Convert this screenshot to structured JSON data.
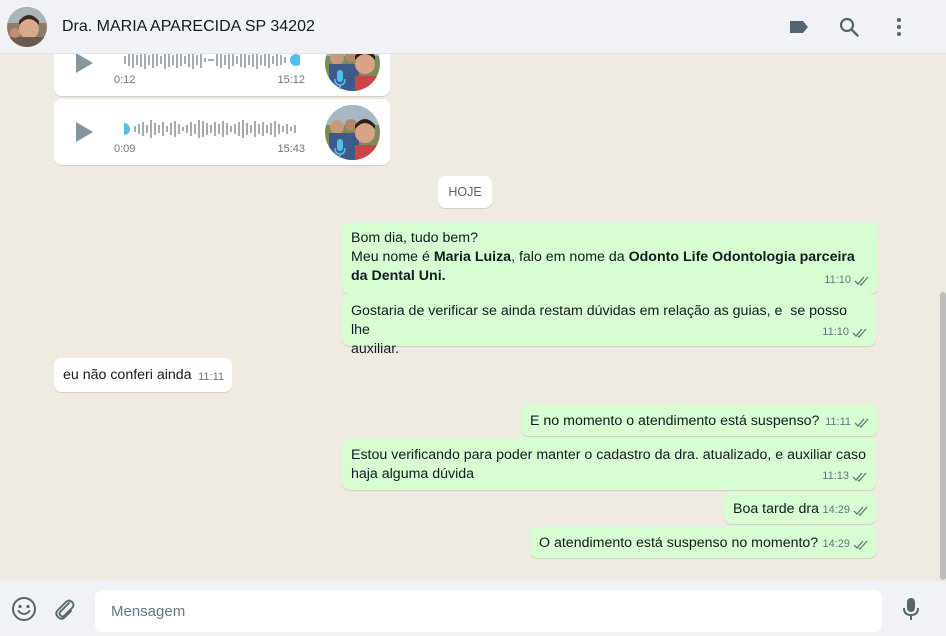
{
  "header": {
    "contact_name": "Dra. MARIA APARECIDA SP 34202",
    "icons": [
      "label-icon",
      "search-icon",
      "menu-icon"
    ]
  },
  "chat": {
    "audio_messages": [
      {
        "duration": "0:12",
        "time": "15:12",
        "progress": 1.0
      },
      {
        "duration": "0:09",
        "time": "15:43",
        "progress": 0.0
      }
    ],
    "date_divider": "HOJE",
    "messages": [
      {
        "direction": "out",
        "line1": "Bom dia, tudo bem?",
        "line2_pre": "Meu nome é ",
        "line2_bold1": "Maria Luiza",
        "line2_mid": ", falo em nome da ",
        "line2_bold2": "Odonto Life Odontologia parceira",
        "line3_bold": "da Dental Uni.",
        "time": "11:10"
      },
      {
        "direction": "out",
        "text": "Gostaria de verificar se ainda restam dúvidas em relação as guias, e  se posso lhe\nauxiliar.",
        "time": "11:10"
      },
      {
        "direction": "in",
        "text": "eu não conferi ainda",
        "time": "11:11"
      },
      {
        "direction": "out",
        "text": "E no momento o atendimento está suspenso?",
        "time": "11:11"
      },
      {
        "direction": "out",
        "text": "Estou verificando para poder manter o cadastro da dra. atualizado, e auxiliar caso\nhaja alguma dúvida",
        "time": "11:13"
      },
      {
        "direction": "out",
        "text": "Boa tarde dra",
        "time": "14:29"
      },
      {
        "direction": "out",
        "text": "O atendimento está suspenso no momento?",
        "time": "14:29"
      }
    ]
  },
  "footer": {
    "placeholder": "Mensagem",
    "icons": [
      "emoji-icon",
      "attach-icon",
      "mic-icon"
    ]
  },
  "colors": {
    "outgoing_bubble": "#d9fdd3",
    "incoming_bubble": "#ffffff",
    "background": "#efeae2",
    "read_ticks": "#667781",
    "audio_accent": "#53bdeb"
  }
}
